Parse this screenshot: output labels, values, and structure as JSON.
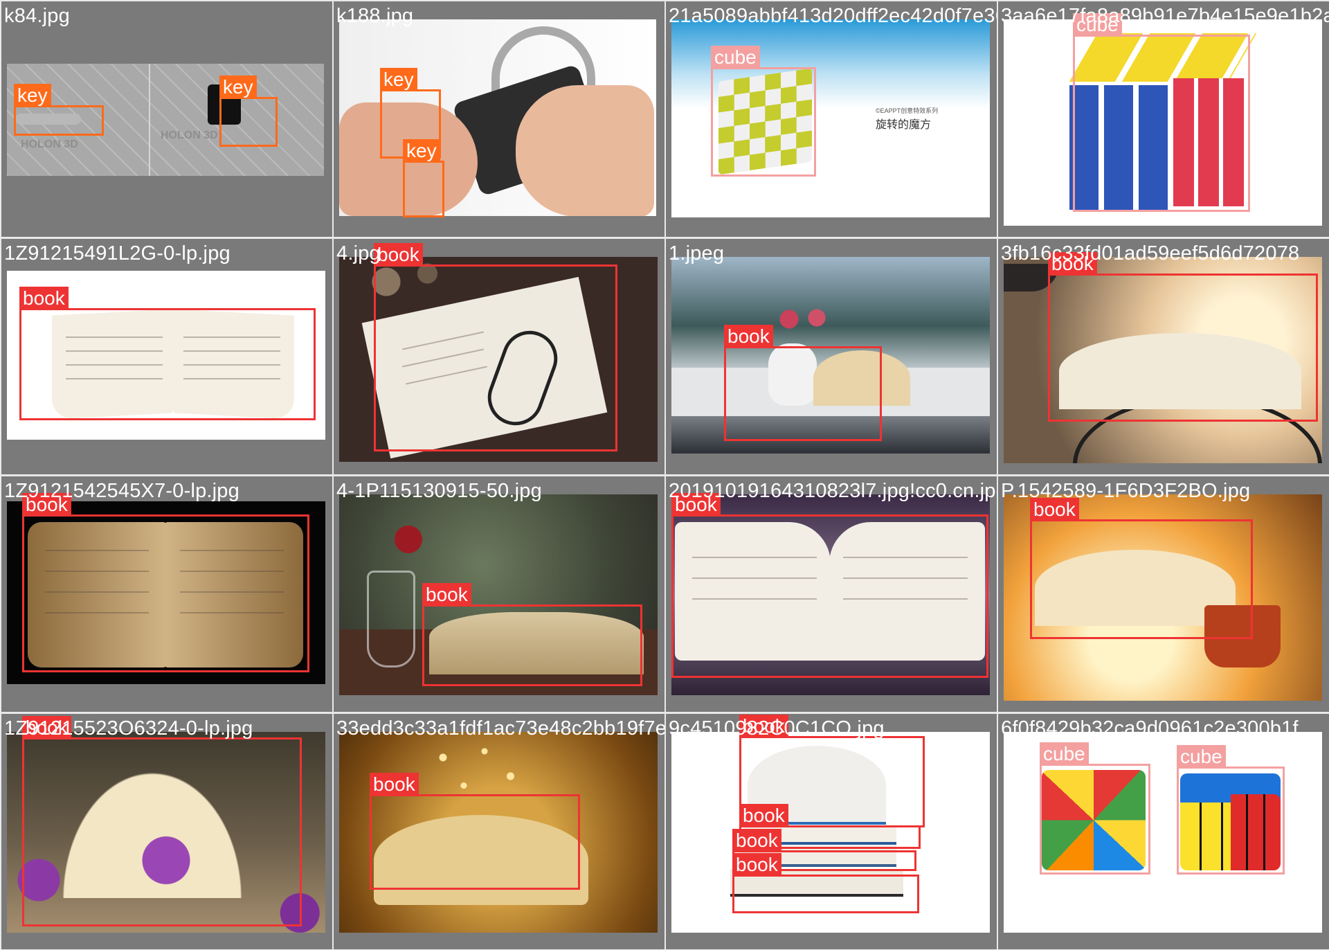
{
  "tiles": [
    {
      "file": "k84.jpg",
      "labels": [
        "key",
        "key"
      ]
    },
    {
      "file": "k188.jpg",
      "labels": [
        "key",
        "key"
      ]
    },
    {
      "file": "21a5089abbf413d20dff2ec42d0f7e36c7c74efb2a801b4e074af6cd69",
      "labels": [
        "cube"
      ],
      "caption_line1": "©EAPPT创意特效系列",
      "caption_line2": "旋转的魔方"
    },
    {
      "file": "3aa6e17fa8a89b91e7b4e15e9e1b2a4c8c6d02.jpg",
      "labels": [
        "cube"
      ]
    },
    {
      "file": "1Z91215491L2G-0-lp.jpg",
      "labels": [
        "book"
      ]
    },
    {
      "file": "4.jpg",
      "labels": [
        "book"
      ]
    },
    {
      "file": "1.jpeg",
      "labels": [
        "book"
      ]
    },
    {
      "file": "3fb16c33fd01ad59eef5d6d72078",
      "labels": [
        "book"
      ]
    },
    {
      "file": "1Z9121542545X7-0-lp.jpg",
      "labels": [
        "book"
      ]
    },
    {
      "file": "4-1P115130915-50.jpg",
      "labels": [
        "book"
      ]
    },
    {
      "file": "20191019164310823l7.jpg!cc0.cn.jpg",
      "labels": [
        "book"
      ]
    },
    {
      "file": "P.1542589-1F6D3F2BO.jpg",
      "labels": [
        "book"
      ]
    },
    {
      "file": "1Z91215523O6324-0-lp.jpg",
      "labels": [
        "book"
      ]
    },
    {
      "file": "33edd3c33a1fdf1ac73e48c2bb19f7e451.jpg",
      "labels": [
        "book"
      ]
    },
    {
      "file": "9c4510982C0C1CO.jpg",
      "labels": [
        "book",
        "book",
        "book",
        "book"
      ]
    },
    {
      "file": "6f0f8429b32ca9d0961c2e300b1f",
      "labels": [
        "cube",
        "cube"
      ]
    }
  ],
  "watermark": "HOLON 3D",
  "colors": {
    "key": "#ff6a1a",
    "book": "#ee3333",
    "cube": "#f4a0a0",
    "tile_bg": "#7a7a7a"
  }
}
